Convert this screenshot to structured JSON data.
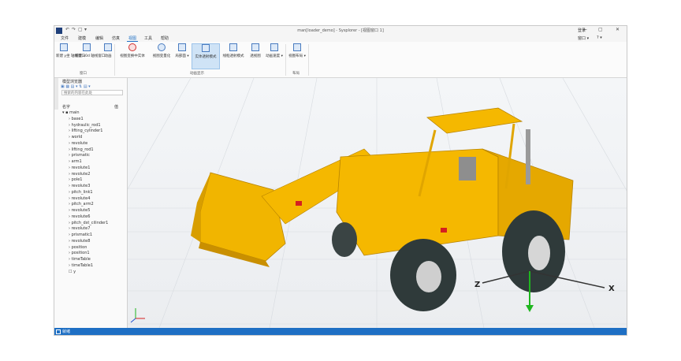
{
  "window": {
    "title": "man[loader_demo] - Sysplorer - [视图窗口 1]",
    "quick_access": [
      "↶",
      "↷",
      "▢",
      "▾"
    ],
    "controls": {
      "minimize": "—",
      "maximize": "▢",
      "close": "✕"
    }
  },
  "menu": {
    "items": [
      "文件",
      "建模",
      "编辑",
      "仿真",
      "视图",
      "工具",
      "帮助"
    ],
    "active": "视图",
    "right": {
      "login": "登录",
      "window": "窗口 ▾",
      "help": "? ▾"
    }
  },
  "ribbon": {
    "buttons": [
      {
        "label": "新建 y坐 轴线窗口"
      },
      {
        "label": "新建 x0d 轴线窗口"
      },
      {
        "label": "动画"
      },
      {
        "label": "视图变换中实体"
      },
      {
        "label": "视图变量化"
      },
      {
        "label": "局部面 ▾"
      },
      {
        "label": "实体透射模式"
      },
      {
        "label": "线框透射模式"
      },
      {
        "label": "透视图"
      },
      {
        "label": "动画速度 ▾"
      },
      {
        "label": "视图布局 ▾"
      }
    ],
    "groups": {
      "window": "窗口",
      "animation": "动画显示",
      "layout": "布局"
    }
  },
  "browser": {
    "title": "模型浏览器",
    "search_placeholder": "搜索的内容在此处",
    "col_name": "名字",
    "col_value": "值",
    "root": "main",
    "items": [
      "base1",
      "hydraulic_rod1",
      "lifting_cylinder1",
      "world",
      "revolute",
      "lifting_rod1",
      "prismatic",
      "arm1",
      "revolute1",
      "revolute2",
      "pole1",
      "revolute3",
      "pitch_link1",
      "revolute4",
      "pitch_arm2",
      "revolute5",
      "revolute6",
      "pitch_dst_cilinder1",
      "revolute7",
      "prismatic1",
      "revolute8",
      "position",
      "position1",
      "timeTable",
      "timeTable1",
      "y"
    ]
  },
  "viewport": {
    "axis_labels": {
      "x": "X",
      "z": "Z"
    }
  },
  "status": {
    "text": "就绪"
  },
  "colors": {
    "accent": "#1e6fc4",
    "loader_body": "#f5b800",
    "tire": "#2f3a3a"
  }
}
